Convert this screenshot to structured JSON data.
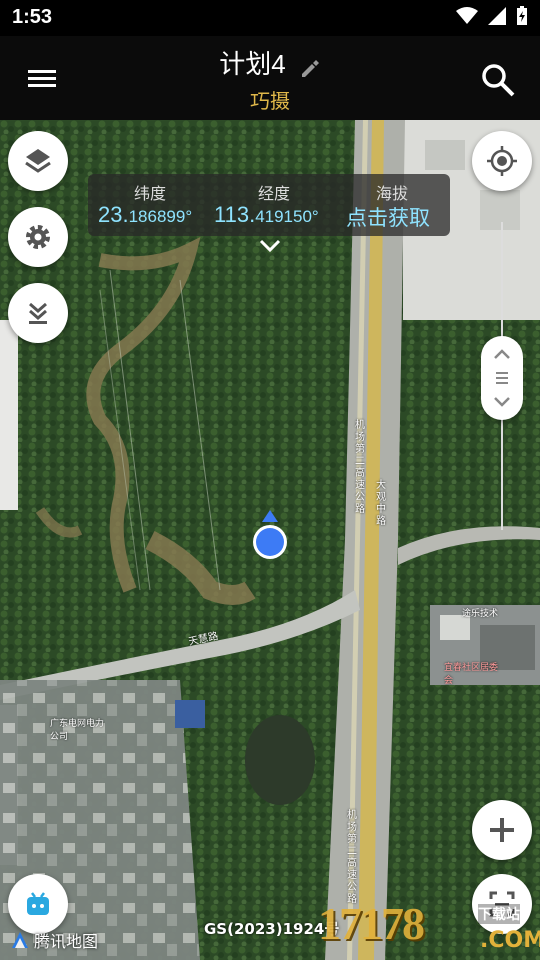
{
  "status_bar": {
    "time": "1:53"
  },
  "header": {
    "title": "计划4",
    "subtitle": "巧摄"
  },
  "coords": {
    "lat_label": "纬度",
    "lat_int": "23.",
    "lat_dec": "186899°",
    "lng_label": "经度",
    "lng_int": "113.",
    "lng_dec": "419150°",
    "alt_label": "海拔",
    "alt_value": "点击获取"
  },
  "map_labels": {
    "road_tianhui": "天慧路",
    "road_airport": "机场第二高速公路",
    "road_daguan": "大观中路",
    "poi_company": "广东电网电力公司",
    "poi_tucheng": "途乐技术",
    "poi_station": "宜春社区居委会",
    "road_airport2": "机场第二高速公路"
  },
  "footer": {
    "gs_number": "GS(2023)1924号",
    "tencent_map": "腾讯地图",
    "watermark": "17178",
    "watermark_small": "下载站",
    "watermark_com": ".COM"
  },
  "colors": {
    "accent": "#e0b84a",
    "coord_value": "#8fe3ff",
    "location": "#3d7bf5"
  }
}
